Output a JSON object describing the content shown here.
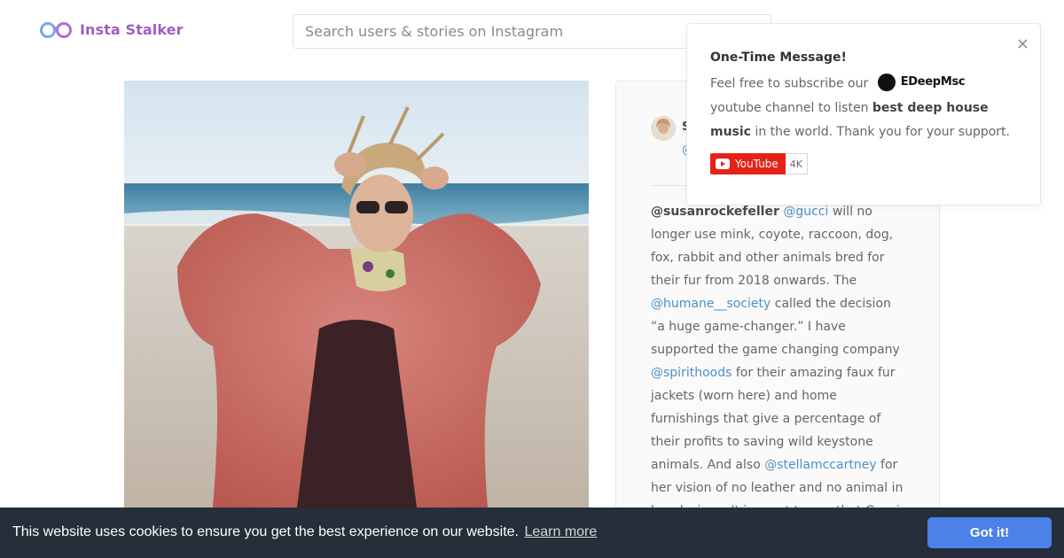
{
  "header": {
    "logo_text": "Insta Stalker",
    "search_placeholder": "Search users & stories on Instagram"
  },
  "post": {
    "user_initial": "S",
    "user_handle_partial": "@",
    "caption_parts": [
      {
        "t": "@susanrockefeller",
        "k": "bold"
      },
      {
        "t": " ",
        "k": "text"
      },
      {
        "t": "@gucci",
        "k": "mention"
      },
      {
        "t": " will no longer use mink, coyote, raccoon, dog, fox, rabbit and other animals bred for their fur from 2018 onwards. The ",
        "k": "text"
      },
      {
        "t": "@humane__society",
        "k": "mention"
      },
      {
        "t": " called the decision “a huge game-changer.” I have supported the game changing company ",
        "k": "text"
      },
      {
        "t": "@spirithoods",
        "k": "mention"
      },
      {
        "t": " for their amazing faux fur jackets (worn here) and home furnishings that give a percentage of their profits to saving wild keystone animals. And also ",
        "k": "text"
      },
      {
        "t": "@stellamccartney",
        "k": "mention"
      },
      {
        "t": " for her vision of no leather and no animal in her designs. It is great to see that Gucci",
        "k": "text"
      }
    ]
  },
  "popup": {
    "close": "×",
    "title": "One-Time Message!",
    "text_1": "Feel free to subscribe our",
    "brand": "EDeepMsc",
    "text_2": "youtube channel to listen",
    "bold_text": "best deep house music",
    "text_3": "in the world. Thank you for your support.",
    "youtube_label": "YouTube",
    "youtube_count": "4K"
  },
  "cookie": {
    "message": "This website uses cookies to ensure you get the best experience on our website.",
    "link": "Learn more",
    "button": "Got it!"
  },
  "colors": {
    "brand_purple": "#a45bc4",
    "mention_blue": "#4e8fc7",
    "cookie_bg": "#252e39",
    "cookie_button": "#4b81e8",
    "youtube_red": "#e62117"
  }
}
